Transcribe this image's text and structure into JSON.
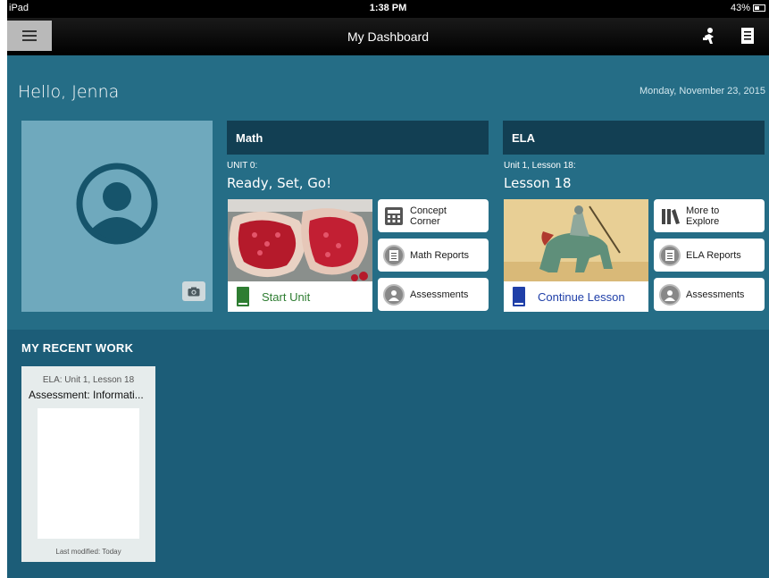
{
  "status_bar": {
    "device": "iPad",
    "time": "1:38 PM",
    "battery": "43%"
  },
  "nav": {
    "title": "My Dashboard"
  },
  "greeting": "Hello, Jenna",
  "date": "Monday, November 23, 2015",
  "math": {
    "header": "Math",
    "unit_small": "UNIT 0:",
    "unit_title": "Ready, Set, Go!",
    "start_label": "Start Unit",
    "buttons": [
      "Concept Corner",
      "Math Reports",
      "Assessments"
    ],
    "accent": "#2e7d32"
  },
  "ela": {
    "header": "ELA",
    "unit_small": "Unit 1, Lesson 18:",
    "unit_title": "Lesson 18",
    "start_label": "Continue Lesson",
    "buttons": [
      "More to Explore",
      "ELA Reports",
      "Assessments"
    ],
    "accent": "#1f3fa8"
  },
  "recent": {
    "title": "MY RECENT WORK",
    "items": [
      {
        "subtitle": "ELA: Unit 1, Lesson 18",
        "title": "Assessment: Informati...",
        "modified": "Last modified: Today"
      }
    ]
  },
  "icons": {
    "menu": "hamburger-icon",
    "notebook": "notebook-icon",
    "avatar": "user-avatar-icon",
    "camera": "camera-icon"
  }
}
